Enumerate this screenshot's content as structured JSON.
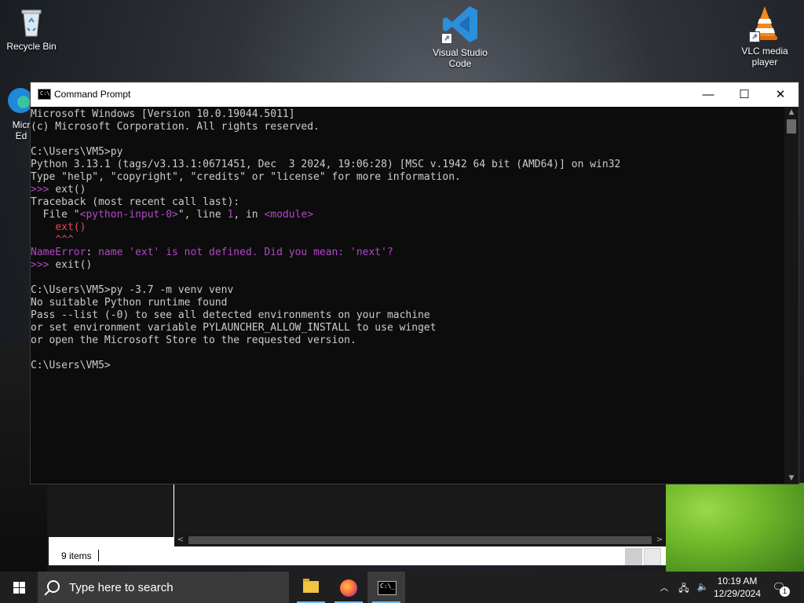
{
  "desktop": {
    "icons": [
      {
        "label": "Recycle Bin"
      },
      {
        "label": "Visual Studio Code"
      },
      {
        "label": "VLC media player"
      },
      {
        "label": "Micr Ed"
      }
    ]
  },
  "explorer": {
    "status_count": "9 items"
  },
  "cmd": {
    "title": "Command Prompt",
    "min_glyph": "—",
    "max_glyph": "☐",
    "close_glyph": "✕",
    "lines": [
      [
        {
          "t": "Microsoft Windows [Version 10.0.19044.5011]"
        }
      ],
      [
        {
          "t": "(c) Microsoft Corporation. All rights reserved."
        }
      ],
      [
        {
          "t": ""
        }
      ],
      [
        {
          "t": "C:\\Users\\VM5>py"
        }
      ],
      [
        {
          "t": "Python 3.13.1 (tags/v3.13.1:0671451, Dec  3 2024, 19:06:28) [MSC v.1942 64 bit (AMD64)] on win32"
        }
      ],
      [
        {
          "t": "Type \"help\", \"copyright\", \"credits\" or \"license\" for more information."
        }
      ],
      [
        {
          "t": ">>> ",
          "c": "magenta"
        },
        {
          "t": "ext()"
        }
      ],
      [
        {
          "t": "Traceback (most recent call last):"
        }
      ],
      [
        {
          "t": "  File \""
        },
        {
          "t": "<python-input-0>",
          "c": "magenta"
        },
        {
          "t": "\", line "
        },
        {
          "t": "1",
          "c": "magenta"
        },
        {
          "t": ", in "
        },
        {
          "t": "<module>",
          "c": "magenta"
        }
      ],
      [
        {
          "t": "    "
        },
        {
          "t": "ext()",
          "c": "red"
        }
      ],
      [
        {
          "t": "    "
        },
        {
          "t": "^^^",
          "c": "red"
        }
      ],
      [
        {
          "t": "NameError",
          "c": "magenta"
        },
        {
          "t": ": "
        },
        {
          "t": "name 'ext' is not defined. Did you mean: 'next'?",
          "c": "magenta"
        }
      ],
      [
        {
          "t": ">>> ",
          "c": "magenta"
        },
        {
          "t": "exit()"
        }
      ],
      [
        {
          "t": ""
        }
      ],
      [
        {
          "t": "C:\\Users\\VM5>py -3.7 -m venv venv"
        }
      ],
      [
        {
          "t": "No suitable Python runtime found"
        }
      ],
      [
        {
          "t": "Pass --list (-0) to see all detected environments on your machine"
        }
      ],
      [
        {
          "t": "or set environment variable PYLAUNCHER_ALLOW_INSTALL to use winget"
        }
      ],
      [
        {
          "t": "or open the Microsoft Store to the requested version."
        }
      ],
      [
        {
          "t": ""
        }
      ],
      [
        {
          "t": "C:\\Users\\VM5>"
        }
      ]
    ]
  },
  "taskbar": {
    "search_placeholder": "Type here to search",
    "apps": [
      {
        "name": "File Explorer",
        "icon": "folder-icon"
      },
      {
        "name": "Firefox",
        "icon": "firefox-icon"
      },
      {
        "name": "Command Prompt",
        "icon": "cmd-icon",
        "active": true
      }
    ],
    "time": "10:19 AM",
    "date": "12/29/2024",
    "notification_count": "1"
  }
}
